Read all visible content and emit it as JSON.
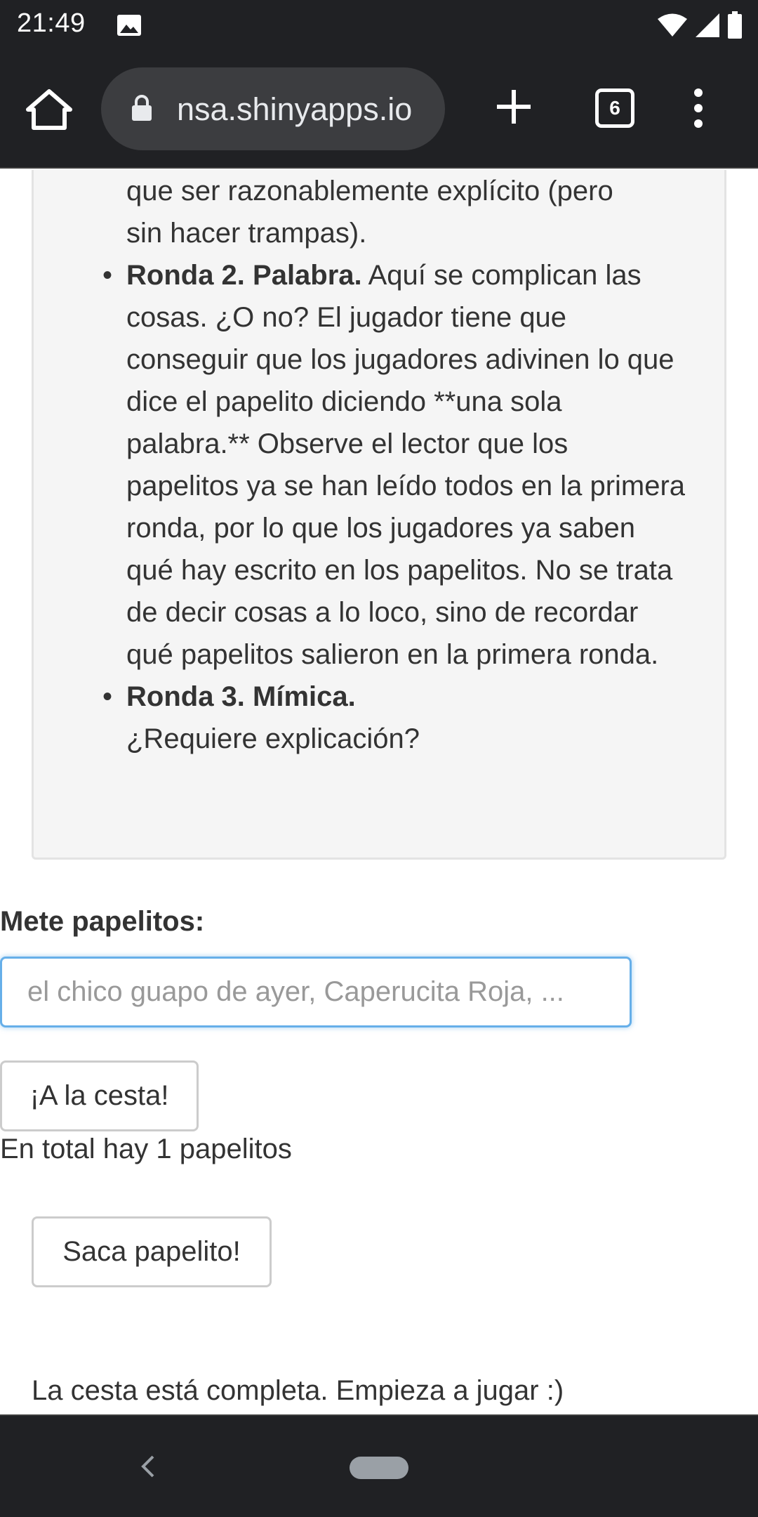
{
  "status_bar": {
    "time": "21:49",
    "icons": [
      "image-icon",
      "wifi-icon",
      "signal-icon",
      "battery-icon"
    ]
  },
  "browser": {
    "url": "nsa.shinyapps.io",
    "tab_count": "6",
    "icons": [
      "home-icon",
      "lock-icon",
      "plus-icon",
      "tabs-icon",
      "more-vert-icon"
    ]
  },
  "rules": {
    "intro_line1": "que ser razonablemente explícito (pero",
    "intro_line2": "sin hacer trampas).",
    "round2_title": "Ronda 2. Palabra.",
    "round2_text": " Aquí se complican las cosas. ¿O no? El jugador tiene que conseguir que los jugadores adivinen lo que dice el papelito diciendo **una sola palabra.** Observe el lector que los papelitos ya se han leído todos en la primera ronda, por lo que los jugadores ya saben qué hay escrito en los papelitos. No se trata de decir cosas a lo loco, sino de recordar qué papelitos salieron en la primera ronda.",
    "round3_title": "Ronda 3. Mímica.",
    "round3_text": "¿Requiere explicación?",
    "bullet": "•"
  },
  "form": {
    "label": "Mete papelitos:",
    "input_value": "",
    "input_placeholder": "el chico guapo de ayer, Caperucita Roja, ...",
    "add_button": "¡A la cesta!",
    "total_text": "En total hay 1 papelitos",
    "draw_button": "Saca papelito!",
    "complete_text": "La cesta está completa. Empieza a jugar :)"
  },
  "colors": {
    "chrome_dark": "#202124",
    "url_pill": "#3c3d40",
    "well_bg": "#f5f5f5",
    "input_focus": "#66afe9",
    "text": "#333333"
  }
}
